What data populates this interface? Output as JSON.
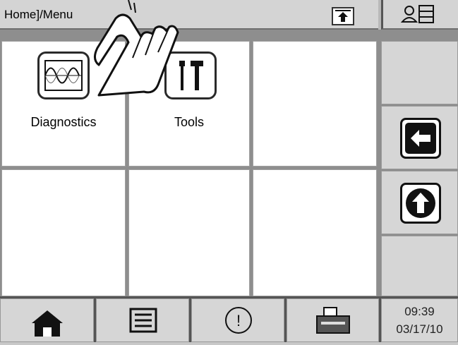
{
  "header": {
    "breadcrumb": "Home]/Menu",
    "up_icon": "arrow-up-boxed-icon",
    "user_list_icon": "user-list-icon"
  },
  "menu": {
    "items": [
      {
        "label": "Diagnostics",
        "icon": "waveform-icon"
      },
      {
        "label": "Tools",
        "icon": "tools-icon"
      }
    ]
  },
  "side": {
    "back_icon": "arrow-left-icon",
    "up_icon": "arrow-up-circle-icon"
  },
  "footer": {
    "buttons": [
      {
        "icon": "home-icon"
      },
      {
        "icon": "list-icon"
      },
      {
        "icon": "alert-icon"
      },
      {
        "icon": "printer-icon"
      }
    ],
    "time": "09:39",
    "date": "03/17/10"
  }
}
